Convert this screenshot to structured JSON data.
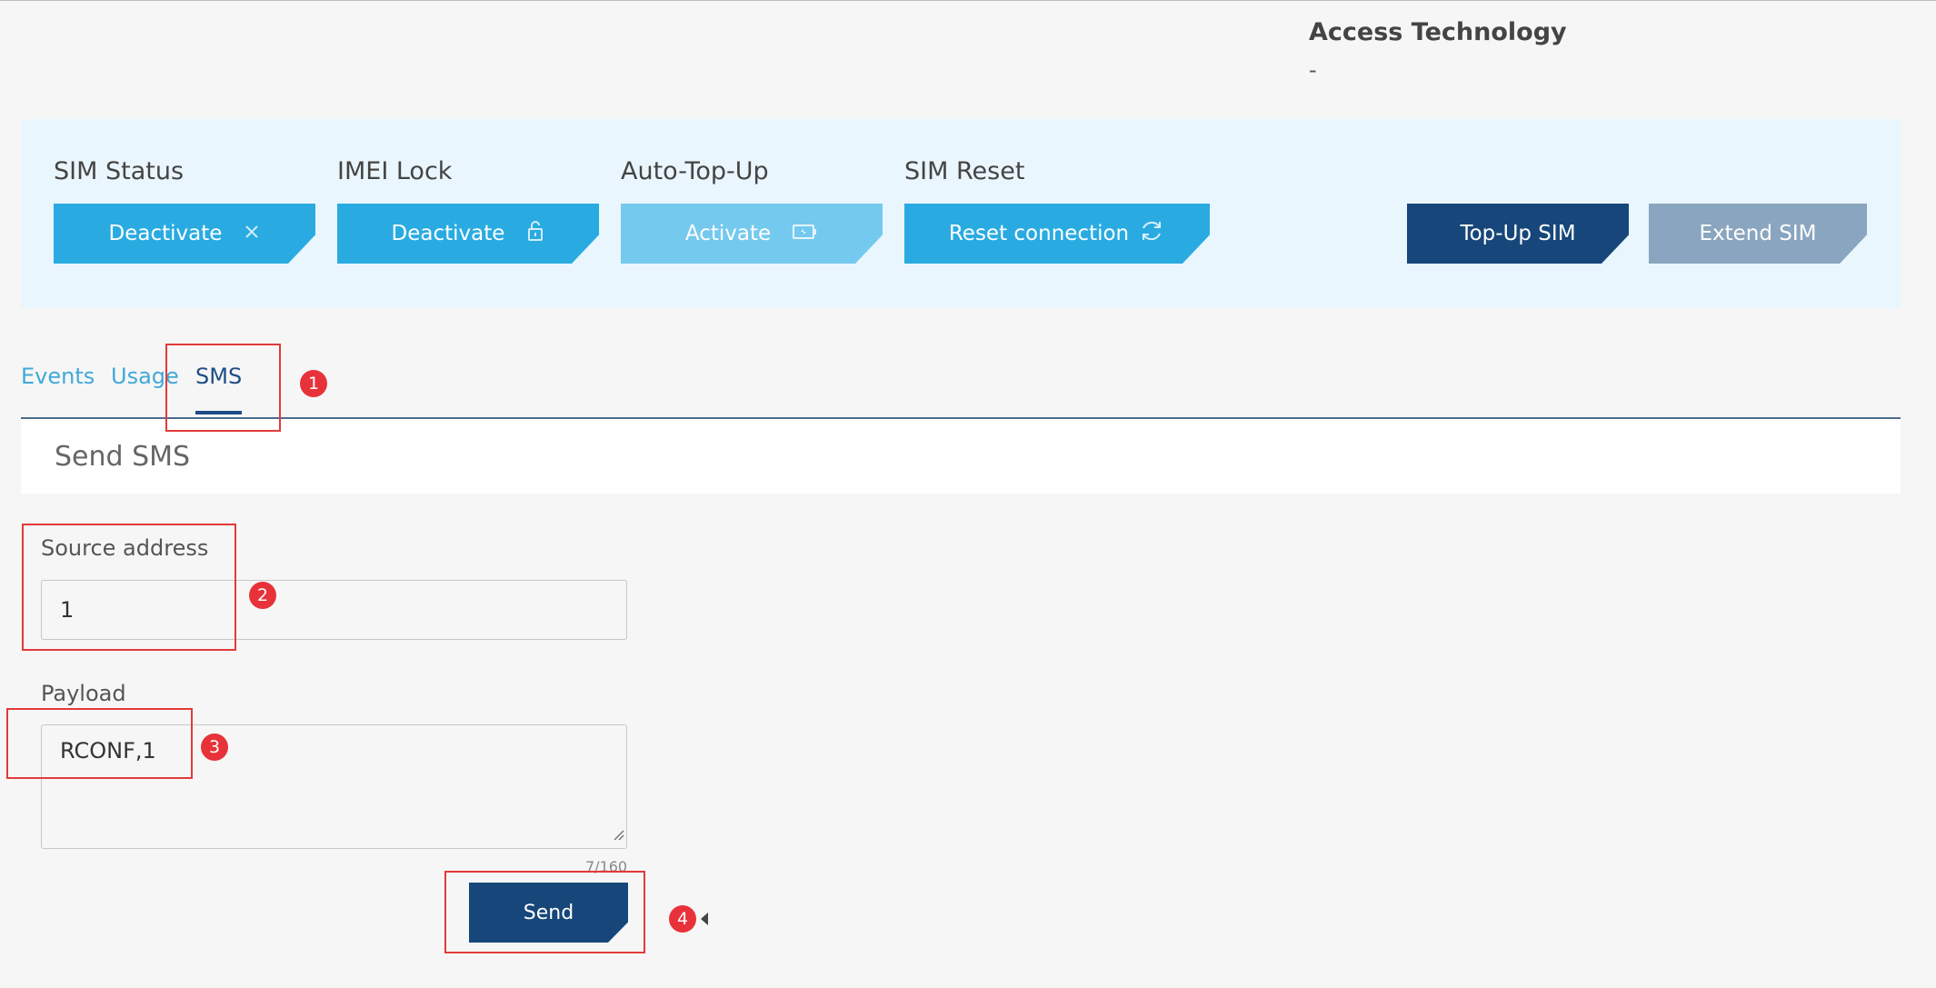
{
  "access": {
    "title": "Access Technology",
    "value": "-"
  },
  "controls": {
    "sim_status": {
      "label": "SIM Status",
      "button": "Deactivate",
      "icon": "close-icon"
    },
    "imei_lock": {
      "label": "IMEI Lock",
      "button": "Deactivate",
      "icon": "unlock-icon"
    },
    "auto_top_up": {
      "label": "Auto-Top-Up",
      "button": "Activate",
      "icon": "battery-charge-icon"
    },
    "sim_reset": {
      "label": "SIM Reset",
      "button": "Reset connection",
      "icon": "refresh-icon"
    },
    "top_up_sim": "Top-Up SIM",
    "extend_sim": "Extend SIM"
  },
  "tabs": [
    {
      "label": "Events",
      "active": false
    },
    {
      "label": "Usage",
      "active": false
    },
    {
      "label": "SMS",
      "active": true
    }
  ],
  "sms": {
    "title": "Send SMS",
    "source_label": "Source address",
    "source_value": "1",
    "payload_label": "Payload",
    "payload_value": "RCONF,1",
    "counter": "7/160",
    "send": "Send"
  },
  "annotations": [
    "1",
    "2",
    "3",
    "4"
  ],
  "colors": {
    "primary": "#29abe2",
    "primary_light": "#74c9ee",
    "navy": "#17477a",
    "grey_blue": "#8aa5bf",
    "annotation_red": "#e33a3a"
  }
}
